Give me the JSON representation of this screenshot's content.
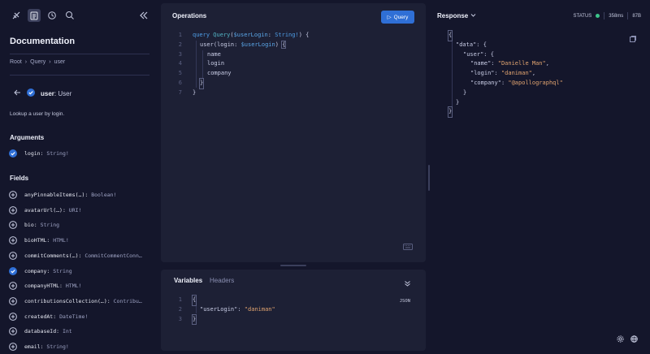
{
  "sidebar": {
    "title": "Documentation",
    "breadcrumb": [
      "Root",
      "Query",
      "user"
    ],
    "type_field": "user",
    "type_name": "User",
    "description": "Lookup a user by login.",
    "arguments_heading": "Arguments",
    "arguments": [
      {
        "name": "login",
        "type": "String!"
      }
    ],
    "fields_heading": "Fields",
    "fields": [
      {
        "name": "anyPinnableItems(…)",
        "type": "Boolean!",
        "checked": false
      },
      {
        "name": "avatarUrl(…)",
        "type": "URI!",
        "checked": false
      },
      {
        "name": "bio",
        "type": "String",
        "checked": false
      },
      {
        "name": "bioHTML",
        "type": "HTML!",
        "checked": false
      },
      {
        "name": "commitComments(…)",
        "type": "CommitCommentConn…",
        "checked": false
      },
      {
        "name": "company",
        "type": "String",
        "checked": true
      },
      {
        "name": "companyHTML",
        "type": "HTML!",
        "checked": false
      },
      {
        "name": "contributionsCollection(…)",
        "type": "Contribu…",
        "checked": false
      },
      {
        "name": "createdAt",
        "type": "DateTime!",
        "checked": false
      },
      {
        "name": "databaseId",
        "type": "Int",
        "checked": false
      },
      {
        "name": "email",
        "type": "String!",
        "checked": false
      }
    ]
  },
  "operations": {
    "title": "Operations",
    "run_label": "Query",
    "line_numbers": [
      "1",
      "2",
      "3",
      "4",
      "5",
      "6",
      "7"
    ],
    "code": {
      "l1_kw": "query",
      "l1_name": "Query",
      "l1_var": "$userLogin",
      "l1_type": "String!",
      "l2_field": "user",
      "l2_arg": "login",
      "l2_var": "$userLogin",
      "l3": "name",
      "l4": "login",
      "l5": "company"
    }
  },
  "variables": {
    "tab_variables": "Variables",
    "tab_headers": "Headers",
    "json_label": "JSON",
    "line_numbers": [
      "1",
      "2",
      "3"
    ],
    "key": "\"userLogin\"",
    "value": "\"daniman\""
  },
  "response": {
    "title": "Response",
    "status_label": "STATUS",
    "time": "358ms",
    "size": "87B",
    "data_key": "\"data\"",
    "user_key": "\"user\"",
    "name_key": "\"name\"",
    "name_val": "\"Danielle Man\"",
    "login_key": "\"login\"",
    "login_val": "\"daniman\"",
    "company_key": "\"company\"",
    "company_val": "\"@apollographql\""
  },
  "colors": {
    "background": "#14162b",
    "panel": "#1d2035",
    "accent": "#2f6fd6",
    "status_ok": "#3cc48a"
  }
}
